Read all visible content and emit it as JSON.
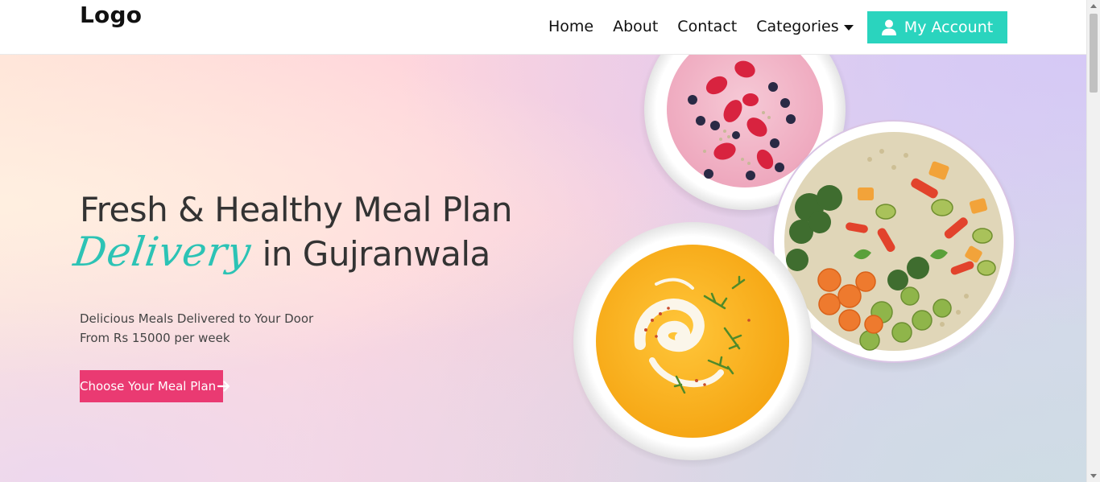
{
  "header": {
    "logo": "Logo",
    "nav": [
      {
        "label": "Home"
      },
      {
        "label": "About"
      },
      {
        "label": "Contact"
      },
      {
        "label": "Categories"
      }
    ],
    "account_label": "My Account"
  },
  "hero": {
    "headline_line1": "Fresh & Healthy Meal Plan",
    "headline_script": "Delivery",
    "headline_line2_rest": "in Gujranwala",
    "subtitle_1": "Delicious Meals Delivered to Your Door",
    "subtitle_2": "From Rs 15000 per week",
    "cta_label": "Choose Your Meal Plan"
  },
  "icons": {
    "user": "user-icon",
    "caret": "caret-down-icon",
    "arrow": "arrow-right-icon"
  },
  "colors": {
    "accent_teal": "#2ad4be",
    "script_teal": "#2cc3b5",
    "cta_pink": "#ea3a72"
  }
}
